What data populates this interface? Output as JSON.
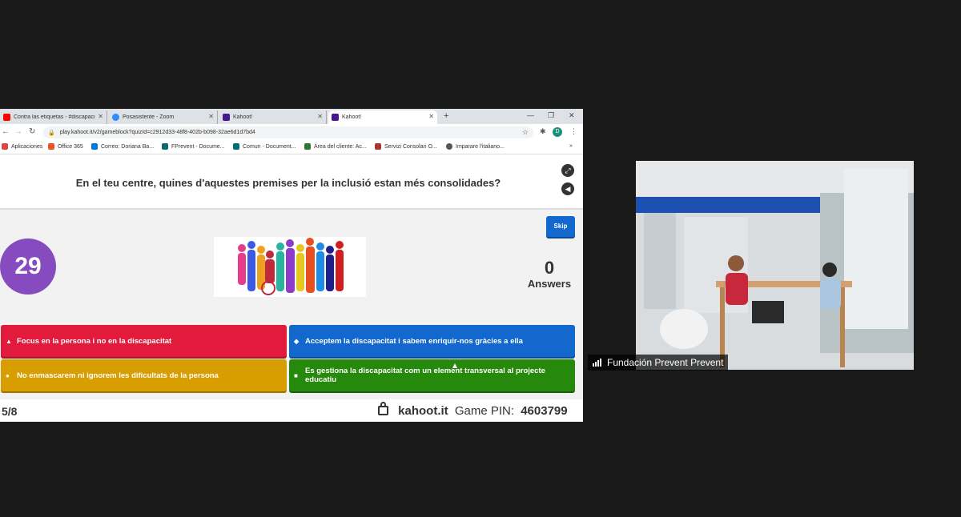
{
  "browser": {
    "tabs": [
      {
        "title": "Contra las etiquetas - #discapaci",
        "icon": "youtube-icon",
        "color": "#ff0000"
      },
      {
        "title": "Posasistente - Zoom",
        "icon": "zoom-icon",
        "color": "#2d8cff"
      },
      {
        "title": "Kahoot!",
        "icon": "kahoot-icon",
        "color": "#46178f"
      },
      {
        "title": "Kahoot!",
        "icon": "kahoot-icon",
        "color": "#46178f"
      }
    ],
    "url": "play.kahoot.it/v2/gameblock?quizId=c2912d33-48f8-402b-b098-32ae6d1d7bd4",
    "profile_initial": "D",
    "bookmarks": [
      {
        "label": "Aplicaciones",
        "icon": "apps-icon",
        "color": "#d44"
      },
      {
        "label": "Office 365",
        "icon": "office-icon",
        "color": "#f25022"
      },
      {
        "label": "Correo: Doriana Ba...",
        "icon": "outlook-icon",
        "color": "#0078d4"
      },
      {
        "label": "FPrevent - Docume...",
        "icon": "sharepoint-icon",
        "color": "#036c70"
      },
      {
        "label": "Comun - Document...",
        "icon": "sharepoint-icon",
        "color": "#036c70"
      },
      {
        "label": "Área del cliente: Ac...",
        "icon": "client-icon",
        "color": "#2a7a2a"
      },
      {
        "label": "Servizi Consolari O...",
        "icon": "consulate-icon",
        "color": "#a33"
      },
      {
        "label": "Imparare l'italiano...",
        "icon": "globe-icon",
        "color": "#555"
      }
    ]
  },
  "kahoot": {
    "question": "En el teu centre, quines d'aquestes premises per la inclusió estan més consolidades?",
    "skip_label": "Skip",
    "timer": "29",
    "answers_count": "0",
    "answers_label": "Answers",
    "options": [
      {
        "symbol": "▲",
        "text": "Focus en la persona i no en la discapacitat",
        "color": "#e21b3c"
      },
      {
        "symbol": "◆",
        "text": "Acceptem la discapacitat i sabem enriquir-nos gràcies a ella",
        "color": "#1368ce"
      },
      {
        "symbol": "●",
        "text": "No enmascarem ni ignorem les dificultats de la persona",
        "color": "#d89e00"
      },
      {
        "symbol": "■",
        "text": "Es gestiona la discapacitat com un element transversal al projecte educatiu",
        "color": "#26890c"
      }
    ],
    "progress": "5/8",
    "brand": "kahoot.it",
    "pin_label": "Game PIN:",
    "pin": "4603799"
  },
  "video": {
    "participant_name": "Fundación Prevent Prevent"
  }
}
